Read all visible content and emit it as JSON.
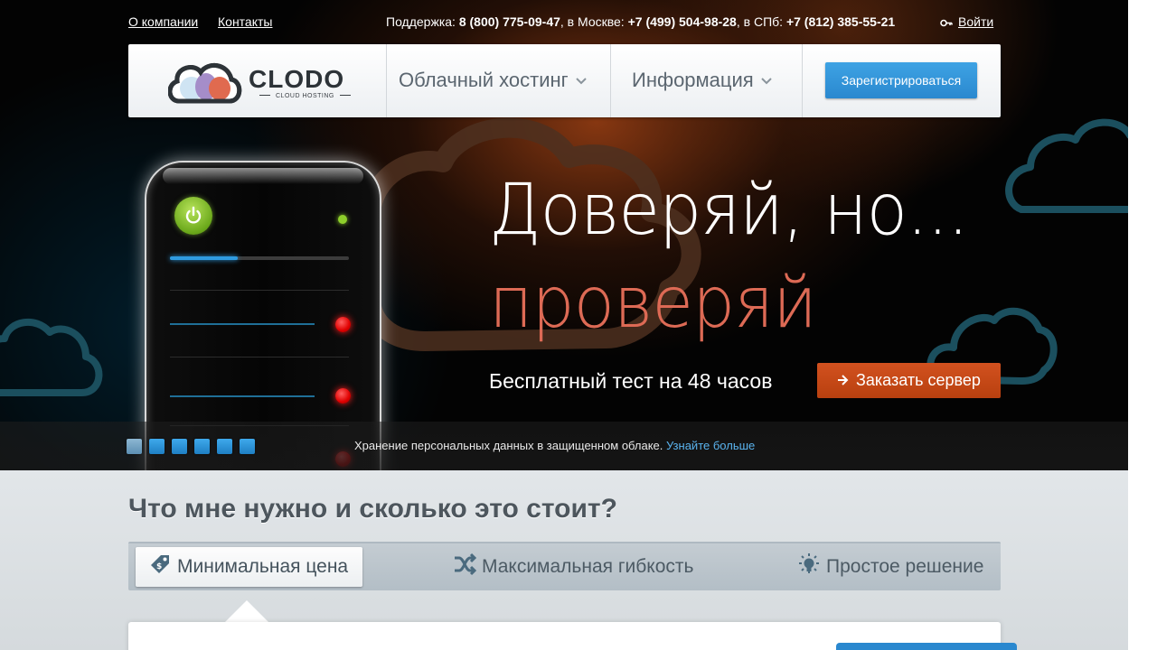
{
  "topbar": {
    "about_link": "О компании",
    "contacts_link": "Контакты",
    "support_label": "Поддержка:",
    "support_phone": "8 (800) 775-09-47",
    "moscow_label": ", в Москве:",
    "moscow_phone": "+7 (499) 504-98-28",
    "spb_label": ", в СПб:",
    "spb_phone": "+7 (812) 385-55-21",
    "login_icon": "key-icon",
    "login_label": "Войти"
  },
  "nav": {
    "logo_text": "CLODO",
    "logo_subtitle": "CLOUD HOSTING",
    "menu": [
      {
        "label": "Облачный хостинг",
        "icon": "chevron-down-icon"
      },
      {
        "label": "Информация",
        "icon": "chevron-down-icon"
      }
    ],
    "register_button": "Зарегистрироваться"
  },
  "hero": {
    "headline": "Доверяй, но...",
    "headline_accent": "проверяй",
    "free_test": "Бесплатный тест на 48 часов",
    "order_button": "Заказать сервер",
    "order_icon": "arrow-right-icon",
    "server_progress": 0.38,
    "slider": {
      "slide_count": 6,
      "active_index": 0,
      "caption": "Хранение персональных данных в защищенном облаке.",
      "caption_link": "Узнайте больше"
    }
  },
  "pricing": {
    "title": "Что мне нужно и сколько это стоит?",
    "tabs": [
      {
        "label": "Минимальная цена",
        "icon": "price-tag-icon",
        "active": true
      },
      {
        "label": "Максимальная гибкость",
        "icon": "shuffle-icon",
        "active": false
      },
      {
        "label": "Простое решение",
        "icon": "lightbulb-icon",
        "active": false
      }
    ]
  },
  "colors": {
    "accent_blue": "#2a88cf",
    "accent_orange": "#c4461a",
    "headline_accent": "#dd6a55",
    "power_green": "#7bbf23",
    "led_red": "#e00000"
  }
}
